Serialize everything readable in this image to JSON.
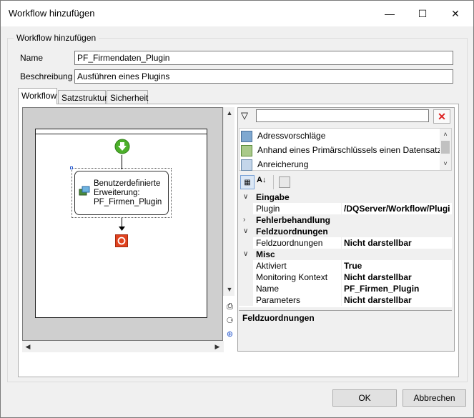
{
  "window": {
    "title": "Workflow hinzufügen"
  },
  "group": {
    "legend": "Workflow hinzufügen"
  },
  "form": {
    "name_label": "Name",
    "name_value": "PF_Firmendaten_Plugin",
    "desc_label": "Beschreibung",
    "desc_value": "Ausführen eines Plugins"
  },
  "tabs": [
    {
      "label": "Workflow",
      "active": true
    },
    {
      "label": "Satzstruktur"
    },
    {
      "label": "Sicherheit"
    }
  ],
  "node": {
    "line1": "Benutzerdefinierte",
    "line2": "Erweiterung:",
    "line3": "PF_Firmen_Plugin"
  },
  "list": {
    "items": [
      "Adressvorschläge",
      "Anhand eines Primärschlüssels einen Datensatz abho",
      "Anreicherung"
    ]
  },
  "grid": {
    "rows": [
      {
        "type": "cat",
        "label": "Eingabe",
        "expanded": true
      },
      {
        "type": "prop",
        "label": "Plugin",
        "value": "/DQServer/Workflow/Plugi"
      },
      {
        "type": "cat",
        "label": "Fehlerbehandlung",
        "expanded": false
      },
      {
        "type": "cat",
        "label": "Feldzuordnungen",
        "expanded": true
      },
      {
        "type": "prop",
        "label": "Feldzuordnungen",
        "value": "Nicht darstellbar"
      },
      {
        "type": "cat",
        "label": "Misc",
        "expanded": true
      },
      {
        "type": "prop",
        "label": "Aktiviert",
        "value": "True"
      },
      {
        "type": "prop",
        "label": "Monitoring Kontext",
        "value": "Nicht darstellbar"
      },
      {
        "type": "prop",
        "label": "Name",
        "value": "PF_Firmen_Plugin"
      },
      {
        "type": "prop",
        "label": "Parameters",
        "value": "Nicht darstellbar"
      }
    ]
  },
  "description": {
    "title": "Feldzuordnungen"
  },
  "buttons": {
    "ok": "OK",
    "cancel": "Abbrechen"
  },
  "icons": {
    "start": "green-down-arrow-circle-icon",
    "end": "red-stop-icon",
    "filter": "filter-icon",
    "clear": "red-x-icon"
  },
  "colors": {
    "start": "#4caf2a",
    "end": "#e0421e",
    "accent": "#0078d7"
  }
}
